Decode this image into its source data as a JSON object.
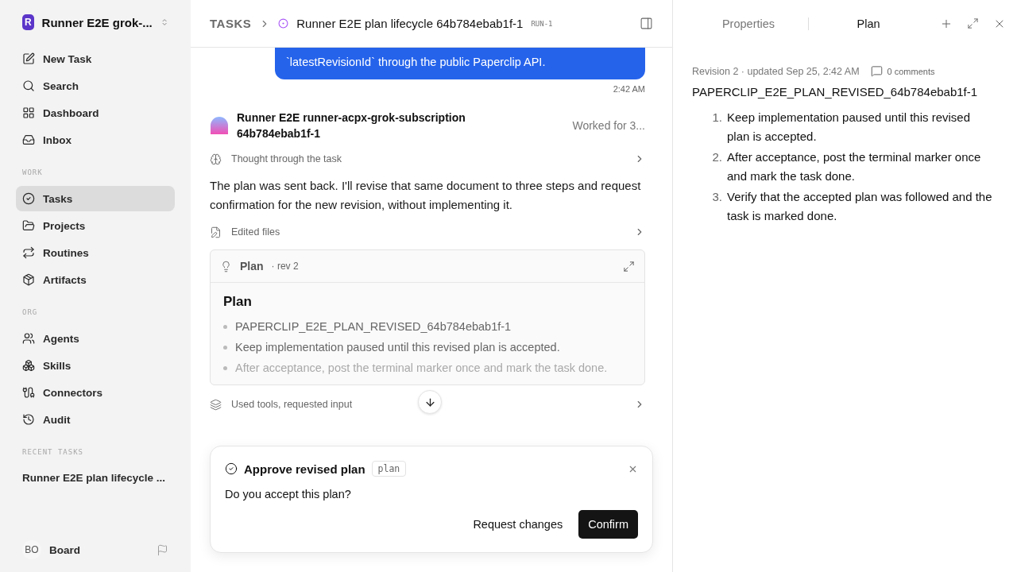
{
  "workspace": {
    "initial": "R",
    "name": "Runner E2E grok-..."
  },
  "nav": [
    {
      "label": "New Task",
      "selected": false
    },
    {
      "label": "Search",
      "selected": false
    },
    {
      "label": "Dashboard",
      "selected": false
    },
    {
      "label": "Inbox",
      "selected": false
    }
  ],
  "sections": [
    {
      "heading": "WORK",
      "items": [
        {
          "label": "Tasks",
          "selected": true
        },
        {
          "label": "Projects",
          "selected": false
        },
        {
          "label": "Routines",
          "selected": false
        },
        {
          "label": "Artifacts",
          "selected": false
        }
      ]
    },
    {
      "heading": "ORG",
      "items": [
        {
          "label": "Agents",
          "selected": false
        },
        {
          "label": "Skills",
          "selected": false
        },
        {
          "label": "Connectors",
          "selected": false
        },
        {
          "label": "Audit",
          "selected": false
        }
      ]
    }
  ],
  "recent": {
    "heading": "RECENT TASKS",
    "items": [
      "Runner E2E plan lifecycle ..."
    ]
  },
  "user": {
    "initials": "BO",
    "name": "Board"
  },
  "header": {
    "breadcrumb": "TASKS",
    "title": "Runner E2E plan lifecycle 64b784ebab1f-1",
    "run": "RUN-1"
  },
  "chat": {
    "bubble": [
      "`latestRevisionId` through the public Paperclip API."
    ],
    "time": "2:42 AM",
    "agent": "Runner E2E runner-acpx-grok-subscription 64b784ebab1f-1",
    "worked": "Worked for 3...",
    "thought": "Thought through the task",
    "message": "The plan was sent back. I'll revise that same document to three steps and request confirmation for the new revision, without implementing it.",
    "edited": "Edited files",
    "plan": {
      "label": "Plan",
      "rev": "· rev 2",
      "heading": "Plan",
      "items": [
        "PAPERCLIP_E2E_PLAN_REVISED_64b784ebab1f-1",
        "Keep implementation paused until this revised plan is accepted.",
        "After acceptance, post the terminal marker once and mark the task done."
      ]
    },
    "tools": "Used tools, requested input"
  },
  "approval": {
    "title": "Approve revised plan",
    "tag": "plan",
    "question": "Do you accept this plan?",
    "secondary": "Request changes",
    "primary": "Confirm"
  },
  "panel": {
    "tabs": [
      {
        "label": "Properties",
        "selected": false
      },
      {
        "label": "Plan",
        "selected": true
      }
    ],
    "meta": "Revision 2 · updated Sep 25, 2:42 AM",
    "comments": "0 comments",
    "title": "PAPERCLIP_E2E_PLAN_REVISED_64b784ebab1f-1",
    "steps": [
      {
        "number": "1.",
        "text": "Keep implementation paused until this revised plan is accepted."
      },
      {
        "number": "2.",
        "text": "After acceptance, post the terminal marker once and mark the task done."
      },
      {
        "number": "3.",
        "text": "Verify that the accepted plan was followed and the task is marked done."
      }
    ]
  }
}
